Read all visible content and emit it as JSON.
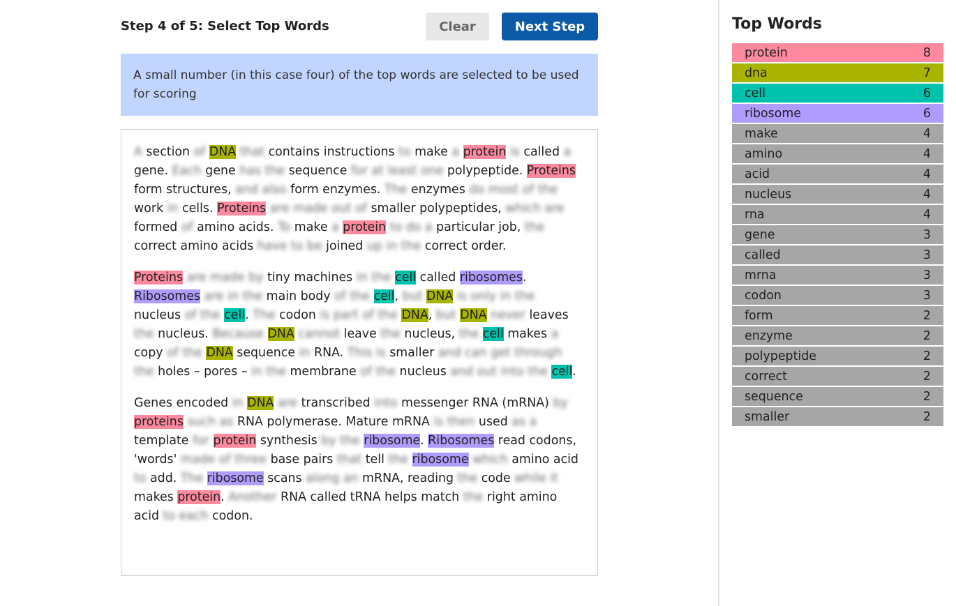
{
  "header": {
    "step_title": "Step 4 of 5: Select Top Words",
    "clear_label": "Clear",
    "next_label": "Next Step"
  },
  "info": {
    "text": "A small number (in this case four) of the top words are selected to be used for scoring"
  },
  "colors": {
    "protein": "#ff8aa0",
    "dna": "#a9b400",
    "cell": "#00c1ab",
    "ribosome": "#b09cff",
    "other": "#a6a6a6",
    "primary_button": "#0b5aa7",
    "info_background": "#c2d5ff"
  },
  "passage": [
    [
      [
        "A",
        "b"
      ],
      [
        " section ",
        ""
      ],
      [
        "of",
        "b"
      ],
      [
        " ",
        ""
      ],
      [
        "DNA",
        "dna"
      ],
      [
        " ",
        ""
      ],
      [
        "that",
        "b"
      ],
      [
        " contains instructions ",
        ""
      ],
      [
        "to",
        "b"
      ],
      [
        " make ",
        ""
      ],
      [
        "a",
        "b"
      ],
      [
        " ",
        ""
      ],
      [
        "protein",
        "protein"
      ],
      [
        " ",
        ""
      ],
      [
        "is",
        "b"
      ],
      [
        " called ",
        ""
      ],
      [
        "a",
        "b"
      ],
      [
        " gene. ",
        ""
      ],
      [
        "Each",
        "b"
      ],
      [
        " gene ",
        ""
      ],
      [
        "has the",
        "b"
      ],
      [
        " sequence ",
        ""
      ],
      [
        "for at least one",
        "b"
      ],
      [
        " polypeptide. ",
        ""
      ],
      [
        "Proteins",
        "protein"
      ],
      [
        " form structures, ",
        ""
      ],
      [
        "and also",
        "b"
      ],
      [
        " form enzymes. ",
        ""
      ],
      [
        "The",
        "b"
      ],
      [
        " enzymes ",
        ""
      ],
      [
        "do most of the",
        "b"
      ],
      [
        " work ",
        ""
      ],
      [
        "in",
        "b"
      ],
      [
        " cells. ",
        ""
      ],
      [
        "Proteins",
        "protein"
      ],
      [
        " ",
        ""
      ],
      [
        "are made out of",
        "b"
      ],
      [
        " smaller polypeptides, ",
        ""
      ],
      [
        "which are",
        "b"
      ],
      [
        " formed ",
        ""
      ],
      [
        "of",
        "b"
      ],
      [
        " amino acids. ",
        ""
      ],
      [
        "To",
        "b"
      ],
      [
        " make ",
        ""
      ],
      [
        "a",
        "b"
      ],
      [
        " ",
        ""
      ],
      [
        "protein",
        "protein"
      ],
      [
        " ",
        ""
      ],
      [
        "to do a",
        "b"
      ],
      [
        " particular job, ",
        ""
      ],
      [
        "the",
        "b"
      ],
      [
        " correct amino acids ",
        ""
      ],
      [
        "have to be",
        "b"
      ],
      [
        " joined ",
        ""
      ],
      [
        "up in the",
        "b"
      ],
      [
        " correct order.",
        ""
      ]
    ],
    [
      [
        "Proteins",
        "protein"
      ],
      [
        " ",
        ""
      ],
      [
        "are made by",
        "b"
      ],
      [
        " tiny machines ",
        ""
      ],
      [
        "in the",
        "b"
      ],
      [
        " ",
        ""
      ],
      [
        "cell",
        "cell"
      ],
      [
        " called ",
        ""
      ],
      [
        "ribosomes",
        "ribosome"
      ],
      [
        ". ",
        ""
      ],
      [
        "Ribosomes",
        "ribosome"
      ],
      [
        " ",
        ""
      ],
      [
        "are in the",
        "b"
      ],
      [
        " main body ",
        ""
      ],
      [
        "of the",
        "b"
      ],
      [
        " ",
        ""
      ],
      [
        "cell",
        "cell"
      ],
      [
        ", ",
        ""
      ],
      [
        "but",
        "b"
      ],
      [
        " ",
        ""
      ],
      [
        "DNA",
        "dna"
      ],
      [
        " ",
        ""
      ],
      [
        "is only in the",
        "b"
      ],
      [
        " nucleus ",
        ""
      ],
      [
        "of the",
        "b"
      ],
      [
        " ",
        ""
      ],
      [
        "cell",
        "cell"
      ],
      [
        ". ",
        ""
      ],
      [
        "The",
        "b"
      ],
      [
        " codon ",
        ""
      ],
      [
        "is part of the",
        "b"
      ],
      [
        " ",
        ""
      ],
      [
        "DNA",
        "dna"
      ],
      [
        ", ",
        ""
      ],
      [
        "but",
        "b"
      ],
      [
        " ",
        ""
      ],
      [
        "DNA",
        "dna"
      ],
      [
        " ",
        ""
      ],
      [
        "never",
        "b"
      ],
      [
        " leaves ",
        ""
      ],
      [
        "the",
        "b"
      ],
      [
        " nucleus. ",
        ""
      ],
      [
        "Because",
        "b"
      ],
      [
        " ",
        ""
      ],
      [
        "DNA",
        "dna"
      ],
      [
        " ",
        ""
      ],
      [
        "cannot",
        "b"
      ],
      [
        " leave ",
        ""
      ],
      [
        "the",
        "b"
      ],
      [
        " nucleus, ",
        ""
      ],
      [
        "the",
        "b"
      ],
      [
        " ",
        ""
      ],
      [
        "cell",
        "cell"
      ],
      [
        " makes ",
        ""
      ],
      [
        "a",
        "b"
      ],
      [
        " copy ",
        ""
      ],
      [
        "of the",
        "b"
      ],
      [
        " ",
        ""
      ],
      [
        "DNA",
        "dna"
      ],
      [
        " sequence ",
        ""
      ],
      [
        "in",
        "b"
      ],
      [
        " RNA. ",
        ""
      ],
      [
        "This is",
        "b"
      ],
      [
        " smaller ",
        ""
      ],
      [
        "and can get through the",
        "b"
      ],
      [
        " holes – pores – ",
        ""
      ],
      [
        "in the",
        "b"
      ],
      [
        " membrane ",
        ""
      ],
      [
        "of the",
        "b"
      ],
      [
        " nucleus ",
        ""
      ],
      [
        "and out into the",
        "b"
      ],
      [
        " ",
        ""
      ],
      [
        "cell",
        "cell"
      ],
      [
        ".",
        ""
      ]
    ],
    [
      [
        "Genes encoded ",
        ""
      ],
      [
        "in",
        "b"
      ],
      [
        " ",
        ""
      ],
      [
        "DNA",
        "dna"
      ],
      [
        " ",
        ""
      ],
      [
        "are",
        "b"
      ],
      [
        " transcribed ",
        ""
      ],
      [
        "into",
        "b"
      ],
      [
        " messenger RNA (mRNA) ",
        ""
      ],
      [
        "by",
        "b"
      ],
      [
        " ",
        ""
      ],
      [
        "proteins",
        "protein"
      ],
      [
        " ",
        ""
      ],
      [
        "such as",
        "b"
      ],
      [
        " RNA polymerase. Mature mRNA ",
        ""
      ],
      [
        "is then",
        "b"
      ],
      [
        " used ",
        ""
      ],
      [
        "as a",
        "b"
      ],
      [
        " template ",
        ""
      ],
      [
        "for",
        "b"
      ],
      [
        " ",
        ""
      ],
      [
        "protein",
        "protein"
      ],
      [
        " synthesis ",
        ""
      ],
      [
        "by the",
        "b"
      ],
      [
        " ",
        ""
      ],
      [
        "ribosome",
        "ribosome"
      ],
      [
        ". ",
        ""
      ],
      [
        "Ribosomes",
        "ribosome"
      ],
      [
        " read codons, 'words' ",
        ""
      ],
      [
        "made of three",
        "b"
      ],
      [
        " base pairs ",
        ""
      ],
      [
        "that",
        "b"
      ],
      [
        " tell ",
        ""
      ],
      [
        "the",
        "b"
      ],
      [
        " ",
        ""
      ],
      [
        "ribosome",
        "ribosome"
      ],
      [
        " ",
        ""
      ],
      [
        "which",
        "b"
      ],
      [
        " amino acid ",
        ""
      ],
      [
        "to",
        "b"
      ],
      [
        " add. ",
        ""
      ],
      [
        "The",
        "b"
      ],
      [
        " ",
        ""
      ],
      [
        "ribosome",
        "ribosome"
      ],
      [
        " scans ",
        ""
      ],
      [
        "along an",
        "b"
      ],
      [
        " mRNA, reading ",
        ""
      ],
      [
        "the",
        "b"
      ],
      [
        " code ",
        ""
      ],
      [
        "while it",
        "b"
      ],
      [
        " makes ",
        ""
      ],
      [
        "protein",
        "protein"
      ],
      [
        ". ",
        ""
      ],
      [
        "Another",
        "b"
      ],
      [
        " RNA called tRNA helps match ",
        ""
      ],
      [
        "the",
        "b"
      ],
      [
        " right amino acid ",
        ""
      ],
      [
        "to each",
        "b"
      ],
      [
        " codon.",
        ""
      ]
    ]
  ],
  "top_words": {
    "title": "Top Words",
    "items": [
      {
        "word": "protein",
        "count": "8",
        "group": "protein"
      },
      {
        "word": "dna",
        "count": "7",
        "group": "dna"
      },
      {
        "word": "cell",
        "count": "6",
        "group": "cell"
      },
      {
        "word": "ribosome",
        "count": "6",
        "group": "ribosome"
      },
      {
        "word": "make",
        "count": "4",
        "group": "other"
      },
      {
        "word": "amino",
        "count": "4",
        "group": "other"
      },
      {
        "word": "acid",
        "count": "4",
        "group": "other"
      },
      {
        "word": "nucleus",
        "count": "4",
        "group": "other"
      },
      {
        "word": "rna",
        "count": "4",
        "group": "other"
      },
      {
        "word": "gene",
        "count": "3",
        "group": "other"
      },
      {
        "word": "called",
        "count": "3",
        "group": "other"
      },
      {
        "word": "mrna",
        "count": "3",
        "group": "other"
      },
      {
        "word": "codon",
        "count": "3",
        "group": "other"
      },
      {
        "word": "form",
        "count": "2",
        "group": "other"
      },
      {
        "word": "enzyme",
        "count": "2",
        "group": "other"
      },
      {
        "word": "polypeptide",
        "count": "2",
        "group": "other"
      },
      {
        "word": "correct",
        "count": "2",
        "group": "other"
      },
      {
        "word": "sequence",
        "count": "2",
        "group": "other"
      },
      {
        "word": "smaller",
        "count": "2",
        "group": "other"
      }
    ]
  }
}
